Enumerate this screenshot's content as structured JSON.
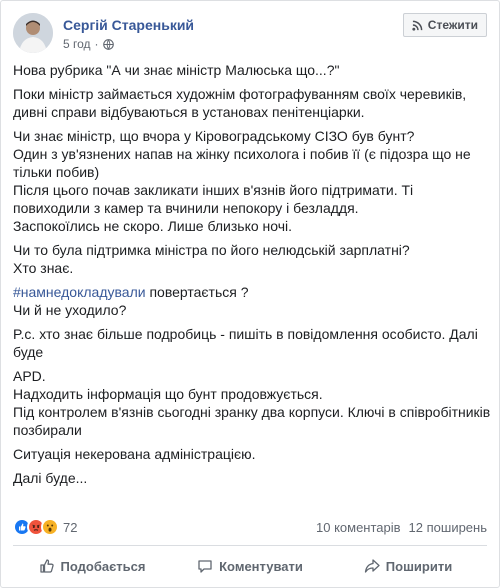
{
  "post": {
    "author": "Сергій Старенький",
    "time": "5 год",
    "visibility_icon": "globe-icon",
    "follow_label": "Стежити",
    "paragraphs": [
      "Нова рубрика \"А чи знає міністр Малюська що...?\"",
      "Поки міністр займається художнім фотографуванням своїх черевиків, дивні справи відбуваються в установах пенітенціарки.",
      "Чи знає міністр, що вчора у Кіровоградському СІЗО був бунт?\nОдин з ув'язнених напав на жінку психолога і побив її (є підозра що не тільки побив)\nПісля цього почав закликати інших в'язнів його підтримати. Ті повиходили з камер та вчинили непокору і безладдя.\nЗаспокоїлись не скоро. Лише близько ночі.",
      "Чи то була підтримка міністра по його нелюдській зарплатні?\nХто знає."
    ],
    "hashtag": "#намнедокладували",
    "hashtag_rest": " повертається ?",
    "after_hashtag": "Чи й не уходило?",
    "paragraphs2": [
      "P.c. хто знає більше подробиць - пишіть в повідомлення особисто. Далі буде",
      "APD.\nНадходить інформація що бунт продовжується.\nПід контролем в'язнів сьогодні зранку два корпуси. Ключі в співробітників позбирали",
      "Ситуація некерована адміністрацією.",
      "Далі буде..."
    ]
  },
  "stats": {
    "reaction_icons": [
      "like-icon",
      "angry-icon",
      "wow-icon"
    ],
    "reaction_count": "72",
    "comments": "10 коментарів",
    "shares": "12 поширень"
  },
  "actions": {
    "like": "Подобається",
    "comment": "Коментувати",
    "share": "Поширити"
  },
  "colors": {
    "link": "#385898",
    "like": "#1877f2",
    "angry": "#f0533c",
    "wow": "#f7b125"
  }
}
